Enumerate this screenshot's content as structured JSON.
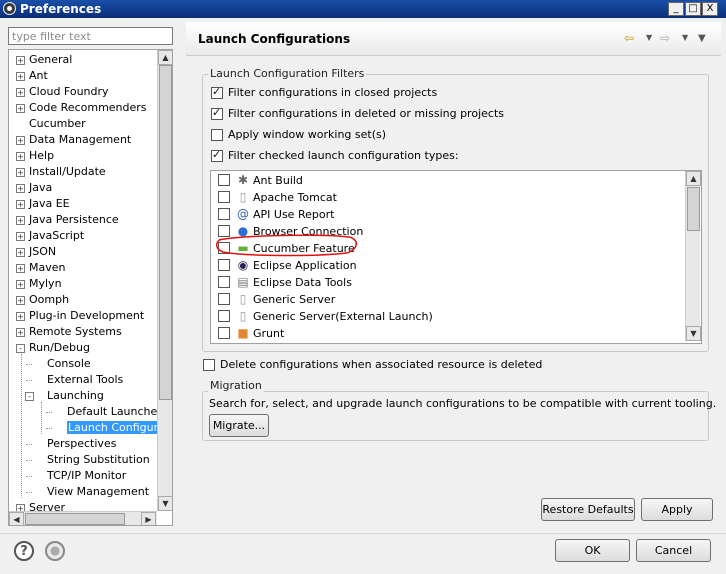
{
  "window": {
    "title": "Preferences",
    "minimize": "_",
    "maximize": "□",
    "close": "X"
  },
  "filter": {
    "placeholder": "type filter text"
  },
  "tree": {
    "items": [
      {
        "label": "General",
        "level": 0,
        "expand": "+"
      },
      {
        "label": "Ant",
        "level": 0,
        "expand": "+"
      },
      {
        "label": "Cloud Foundry",
        "level": 0,
        "expand": "+"
      },
      {
        "label": "Code Recommenders",
        "level": 0,
        "expand": "+"
      },
      {
        "label": "Cucumber",
        "level": 0,
        "expand": ""
      },
      {
        "label": "Data Management",
        "level": 0,
        "expand": "+"
      },
      {
        "label": "Help",
        "level": 0,
        "expand": "+"
      },
      {
        "label": "Install/Update",
        "level": 0,
        "expand": "+"
      },
      {
        "label": "Java",
        "level": 0,
        "expand": "+"
      },
      {
        "label": "Java EE",
        "level": 0,
        "expand": "+"
      },
      {
        "label": "Java Persistence",
        "level": 0,
        "expand": "+"
      },
      {
        "label": "JavaScript",
        "level": 0,
        "expand": "+"
      },
      {
        "label": "JSON",
        "level": 0,
        "expand": "+"
      },
      {
        "label": "Maven",
        "level": 0,
        "expand": "+"
      },
      {
        "label": "Mylyn",
        "level": 0,
        "expand": "+"
      },
      {
        "label": "Oomph",
        "level": 0,
        "expand": "+"
      },
      {
        "label": "Plug-in Development",
        "level": 0,
        "expand": "+"
      },
      {
        "label": "Remote Systems",
        "level": 0,
        "expand": "+"
      },
      {
        "label": "Run/Debug",
        "level": 0,
        "expand": "-"
      },
      {
        "label": "Console",
        "level": 1,
        "expand": ""
      },
      {
        "label": "External Tools",
        "level": 1,
        "expand": ""
      },
      {
        "label": "Launching",
        "level": 1,
        "expand": "-"
      },
      {
        "label": "Default Launchers",
        "level": 2,
        "expand": ""
      },
      {
        "label": "Launch Configurat",
        "level": 2,
        "expand": "",
        "selected": true
      },
      {
        "label": "Perspectives",
        "level": 1,
        "expand": ""
      },
      {
        "label": "String Substitution",
        "level": 1,
        "expand": ""
      },
      {
        "label": "TCP/IP Monitor",
        "level": 1,
        "expand": ""
      },
      {
        "label": "View Management",
        "level": 1,
        "expand": ""
      },
      {
        "label": "Server",
        "level": 0,
        "expand": "+"
      }
    ]
  },
  "page": {
    "title": "Launch Configurations",
    "filters_group": "Launch Configuration Filters",
    "options": [
      {
        "label": "Filter configurations in closed projects",
        "checked": true
      },
      {
        "label": "Filter configurations in deleted or missing projects",
        "checked": true
      },
      {
        "label": "Apply window working set(s)",
        "checked": false
      },
      {
        "label": "Filter checked launch configuration types:",
        "checked": true
      }
    ],
    "types": [
      {
        "label": "Ant Build",
        "icon": "ant-icon",
        "glyph": "✱"
      },
      {
        "label": "Apache Tomcat",
        "icon": "tomcat-icon",
        "glyph": "▯"
      },
      {
        "label": "API Use Report",
        "icon": "api-report-icon",
        "glyph": "@"
      },
      {
        "label": "Browser Connection",
        "icon": "browser-icon",
        "glyph": "●"
      },
      {
        "label": "Cucumber Feature",
        "icon": "cucumber-icon",
        "glyph": "▬"
      },
      {
        "label": "Eclipse Application",
        "icon": "eclipse-icon",
        "glyph": "◉"
      },
      {
        "label": "Eclipse Data Tools",
        "icon": "database-icon",
        "glyph": "▤"
      },
      {
        "label": "Generic Server",
        "icon": "server-icon",
        "glyph": "▯"
      },
      {
        "label": "Generic Server(External Launch)",
        "icon": "server-icon",
        "glyph": "▯"
      },
      {
        "label": "Grunt",
        "icon": "grunt-icon",
        "glyph": "■"
      }
    ],
    "delete_option": {
      "label": "Delete configurations when associated resource is deleted",
      "checked": false
    },
    "migration": {
      "group": "Migration",
      "text": "Search for, select, and upgrade launch configurations to be compatible with current tooling.",
      "button": "Migrate..."
    },
    "restore_defaults": "Restore Defaults",
    "apply": "Apply"
  },
  "footer": {
    "help_glyph": "?",
    "ok": "OK",
    "cancel": "Cancel"
  },
  "colors": {
    "selection": "#3399ff",
    "annotation": "#e01010",
    "titlebar": "#0a2e78"
  }
}
